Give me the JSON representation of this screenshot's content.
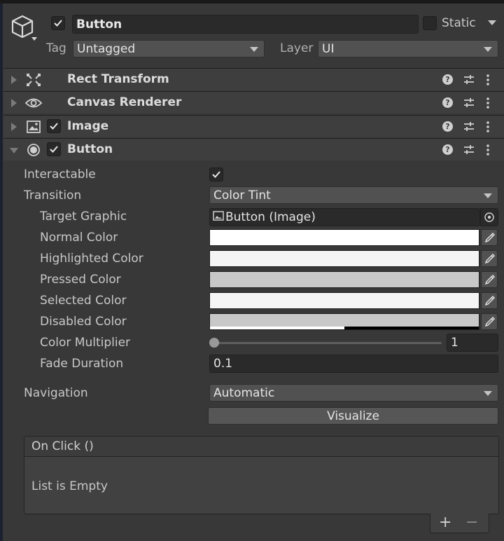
{
  "header": {
    "object_name": "Button",
    "active_checked": true,
    "static_label": "Static",
    "tag_label": "Tag",
    "tag_value": "Untagged",
    "layer_label": "Layer",
    "layer_value": "UI"
  },
  "components": [
    {
      "title": "Rect Transform",
      "icon": "rect-transform-icon",
      "expanded": false,
      "has_checkbox": false
    },
    {
      "title": "Canvas Renderer",
      "icon": "eye-icon",
      "expanded": false,
      "has_checkbox": false
    },
    {
      "title": "Image",
      "icon": "image-icon",
      "expanded": false,
      "has_checkbox": true
    },
    {
      "title": "Button",
      "icon": "radio-button-icon",
      "expanded": true,
      "has_checkbox": true
    }
  ],
  "button": {
    "interactable_label": "Interactable",
    "interactable_checked": true,
    "transition_label": "Transition",
    "transition_value": "Color Tint",
    "target_graphic_label": "Target Graphic",
    "target_graphic_value": "Button (Image)",
    "normal_color_label": "Normal Color",
    "normal_color": "#ffffff",
    "highlighted_color_label": "Highlighted Color",
    "highlighted_color": "#f5f5f5",
    "pressed_color_label": "Pressed Color",
    "pressed_color": "#c8c8c8",
    "selected_color_label": "Selected Color",
    "selected_color": "#f5f5f5",
    "disabled_color_label": "Disabled Color",
    "disabled_color": "#c8c8c8",
    "disabled_alpha": 0.5,
    "color_multiplier_label": "Color Multiplier",
    "color_multiplier_value": "1",
    "color_multiplier_fraction": 0.0,
    "fade_duration_label": "Fade Duration",
    "fade_duration_value": "0.1",
    "navigation_label": "Navigation",
    "navigation_value": "Automatic",
    "visualize_label": "Visualize"
  },
  "on_click": {
    "title": "On Click ()",
    "empty_text": "List is Empty",
    "add_label": "+",
    "remove_label": "−"
  }
}
